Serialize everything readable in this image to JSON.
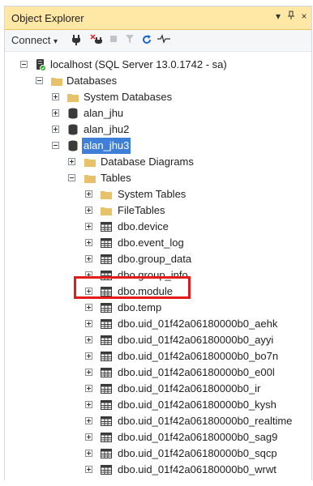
{
  "panel": {
    "title": "Object Explorer",
    "controls": {
      "dropdown": "▾",
      "pin": "ᵖ",
      "close": "×"
    }
  },
  "toolbar": {
    "connect_label": "Connect",
    "connect_arrow": "▾"
  },
  "tree": {
    "server": {
      "label": "localhost (SQL Server 13.0.1742 - sa)"
    },
    "databases": {
      "label": "Databases"
    },
    "system_databases": {
      "label": "System Databases"
    },
    "db_alan_jhu": {
      "label": "alan_jhu"
    },
    "db_alan_jhu2": {
      "label": "alan_jhu2"
    },
    "db_alan_jhu3": {
      "label": "alan_jhu3"
    },
    "database_diagrams": {
      "label": "Database Diagrams"
    },
    "tables": {
      "label": "Tables"
    },
    "system_tables": {
      "label": "System Tables"
    },
    "file_tables": {
      "label": "FileTables"
    },
    "table_items": [
      {
        "label": "dbo.device"
      },
      {
        "label": "dbo.event_log"
      },
      {
        "label": "dbo.group_data"
      },
      {
        "label": "dbo.group_info"
      },
      {
        "label": "dbo.module"
      },
      {
        "label": "dbo.temp"
      },
      {
        "label": "dbo.uid_01f42a06180000b0_aehk"
      },
      {
        "label": "dbo.uid_01f42a06180000b0_ayyi"
      },
      {
        "label": "dbo.uid_01f42a06180000b0_bo7n"
      },
      {
        "label": "dbo.uid_01f42a06180000b0_e00l"
      },
      {
        "label": "dbo.uid_01f42a06180000b0_ir"
      },
      {
        "label": "dbo.uid_01f42a06180000b0_kysh"
      },
      {
        "label": "dbo.uid_01f42a06180000b0_realtime"
      },
      {
        "label": "dbo.uid_01f42a06180000b0_sag9"
      },
      {
        "label": "dbo.uid_01f42a06180000b0_sqcp"
      },
      {
        "label": "dbo.uid_01f42a06180000b0_wrwt"
      }
    ]
  },
  "colors": {
    "title_bar": "#ffe8a6",
    "selection": "#3f7fd8",
    "highlight_box": "#e41b1b",
    "folder": "#e8c26a"
  }
}
